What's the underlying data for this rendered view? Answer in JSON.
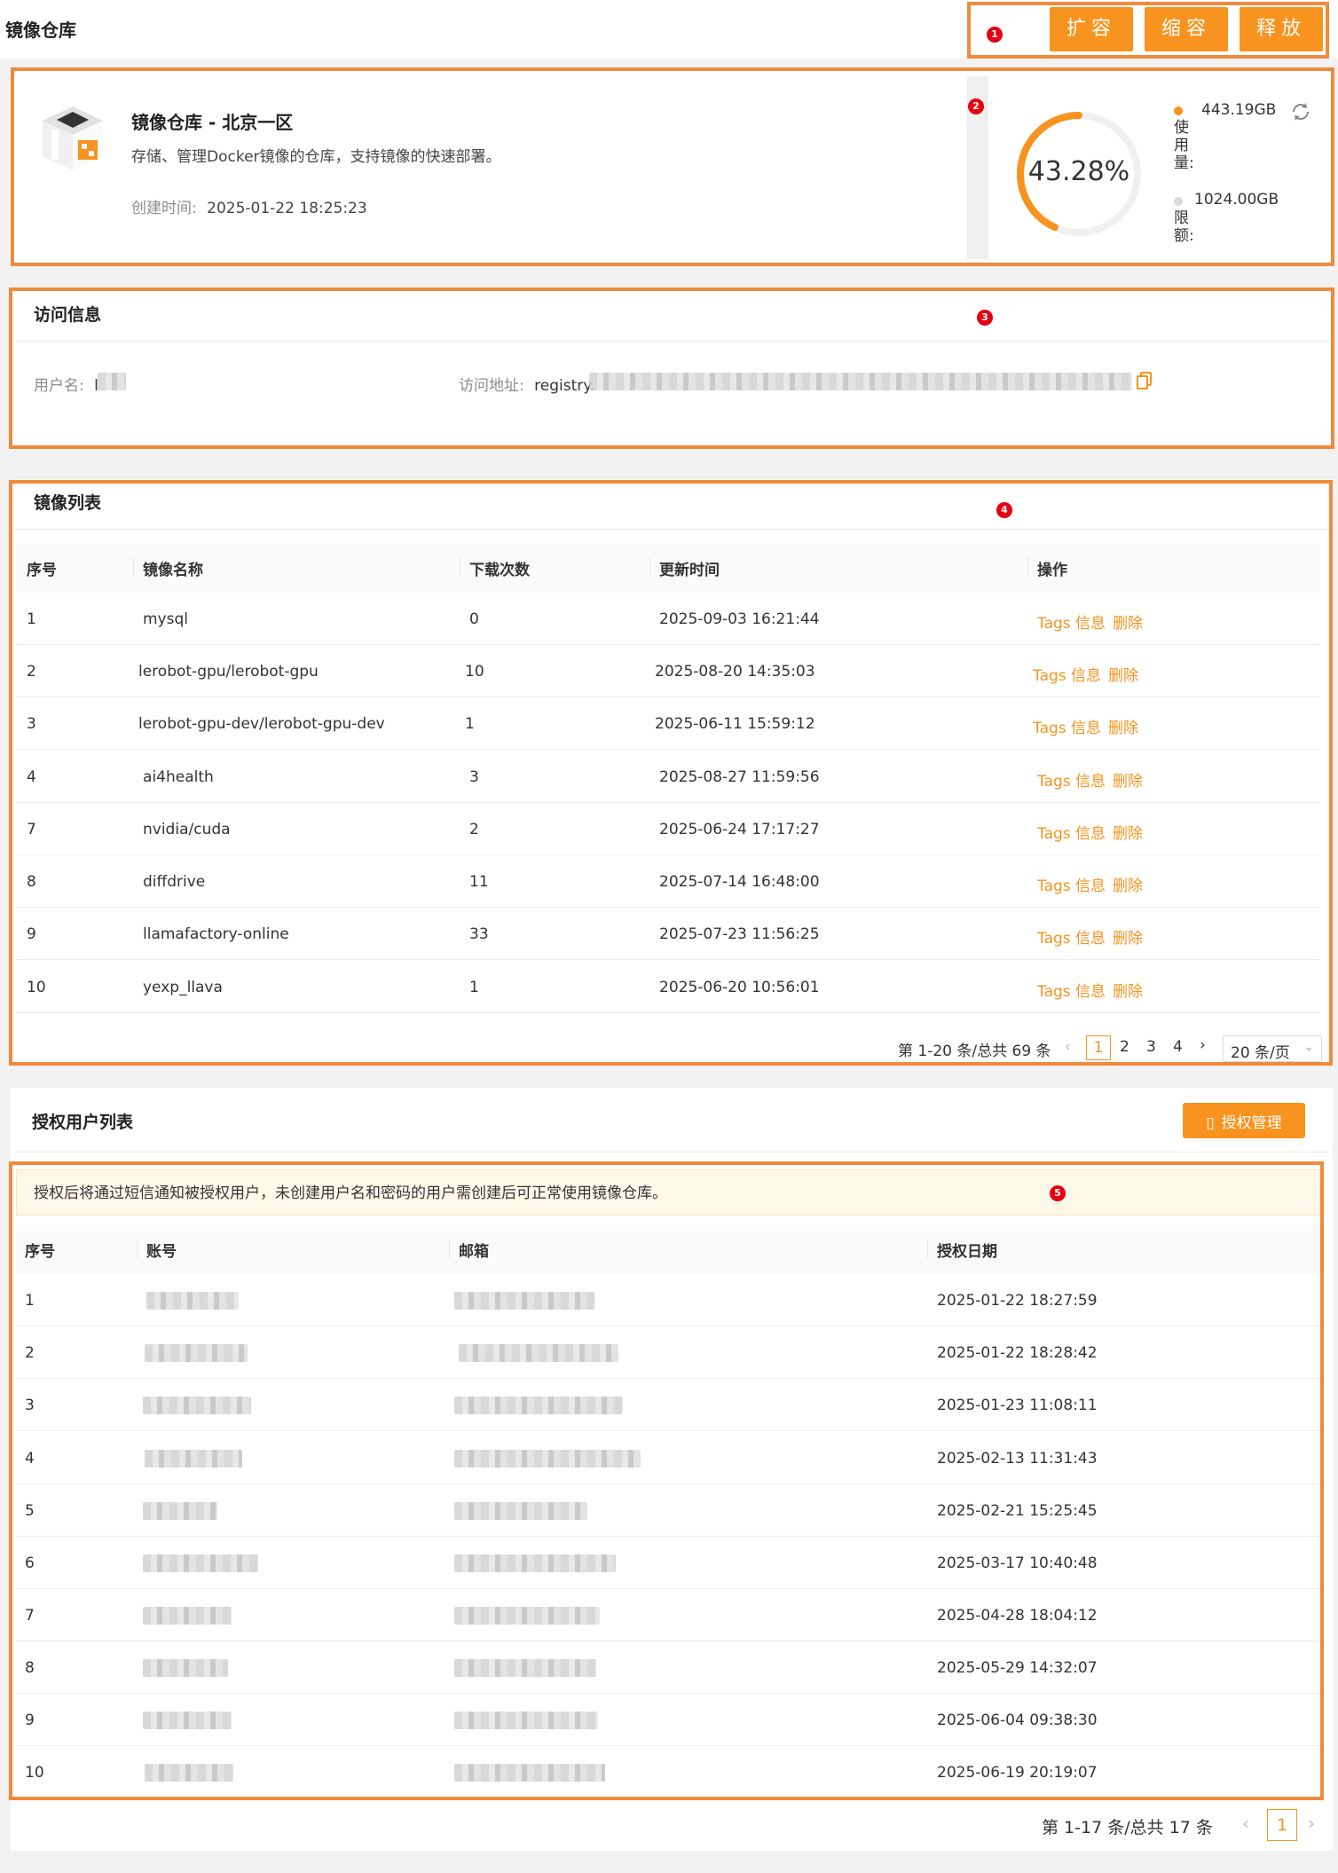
{
  "page": {
    "title": "镜像仓库"
  },
  "toolbar": {
    "expand": "扩容",
    "shrink": "缩容",
    "release": "释放"
  },
  "repo": {
    "name": "镜像仓库 - 北京一区",
    "description": "存储、管理Docker镜像的仓库，支持镜像的快速部署。",
    "created_label": "创建时间:",
    "created_value": "2025-01-22 18:25:23"
  },
  "usage": {
    "percent_text": "43.28%",
    "percent": 43.28,
    "used_value": "443.19GB",
    "used_label": "使用量:",
    "limit_value": "1024.00GB",
    "limit_label": "限额:",
    "used_color": "#f7931e",
    "limit_color": "#d9d9d9"
  },
  "access": {
    "title": "访问信息",
    "username_label": "用户名:",
    "username_value": "l",
    "address_label": "访问地址:",
    "address_value": "registry."
  },
  "images": {
    "title": "镜像列表",
    "headers": [
      "序号",
      "镜像名称",
      "下载次数",
      "更新时间",
      "操作"
    ],
    "action_tags": "Tags 信息",
    "action_delete": "删除",
    "rows": [
      [
        "1",
        "mysql",
        "0",
        "2025-09-03 16:21:44"
      ],
      [
        "2",
        "lerobot-gpu/lerobot-gpu",
        "10",
        "2025-08-20 14:35:03"
      ],
      [
        "3",
        "lerobot-gpu-dev/lerobot-gpu-dev",
        "1",
        "2025-06-11 15:59:12"
      ],
      [
        "4",
        "ai4health",
        "3",
        "2025-08-27 11:59:56"
      ],
      [
        "7",
        "nvidia/cuda",
        "2",
        "2025-06-24 17:17:27"
      ],
      [
        "8",
        "diffdrive",
        "11",
        "2025-07-14 16:48:00"
      ],
      [
        "9",
        "llamafactory-online",
        "33",
        "2025-07-23 11:56:25"
      ],
      [
        "10",
        "yexp_llava",
        "1",
        "2025-06-20 10:56:01"
      ]
    ],
    "pagination": {
      "summary": "第 1-20 条/总共 69 条",
      "pages": [
        "1",
        "2",
        "3",
        "4"
      ],
      "page_size": "20 条/页"
    }
  },
  "auth": {
    "title": "授权用户列表",
    "manage_button": "授权管理",
    "notice": "授权后将通过短信通知被授权用户，未创建用户名和密码的用户需创建后可正常使用镜像仓库。",
    "headers": [
      "序号",
      "账号",
      "邮箱",
      "授权日期"
    ],
    "rows": [
      [
        "1",
        "2025-01-22 18:27:59"
      ],
      [
        "2",
        "2025-01-22 18:28:42"
      ],
      [
        "3",
        "2025-01-23 11:08:11"
      ],
      [
        "4",
        "2025-02-13 11:31:43"
      ],
      [
        "5",
        "2025-02-21 15:25:45"
      ],
      [
        "6",
        "2025-03-17 10:40:48"
      ],
      [
        "7",
        "2025-04-28 18:04:12"
      ],
      [
        "8",
        "2025-05-29 14:32:07"
      ],
      [
        "9",
        "2025-06-04 09:38:30"
      ],
      [
        "10",
        "2025-06-19 20:19:07"
      ]
    ],
    "pagination": {
      "summary": "第 1-17 条/总共 17 条",
      "current": "1"
    }
  },
  "markers": [
    "1",
    "2",
    "3",
    "4",
    "5"
  ]
}
